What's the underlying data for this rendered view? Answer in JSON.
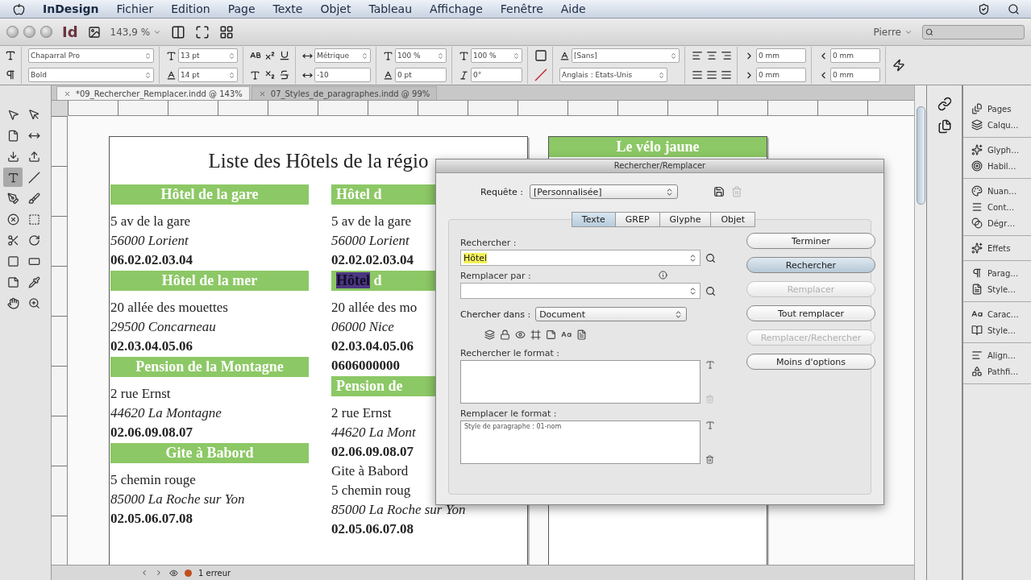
{
  "menu_bar": {
    "app": "InDesign",
    "items": [
      "Fichier",
      "Edition",
      "Page",
      "Texte",
      "Objet",
      "Tableau",
      "Affichage",
      "Fenêtre",
      "Aide"
    ]
  },
  "app_bar": {
    "logo": "Id",
    "zoom": "143,9 %",
    "workspace": "Pierre"
  },
  "control_panel": {
    "font_family": "Chaparral Pro",
    "font_style": "Bold",
    "font_size": "13 pt",
    "leading": "14 pt",
    "kerning": "Métrique",
    "tracking": "-10",
    "vertical_scale": "100 %",
    "baseline_shift": "0 pt",
    "horizontal_scale": "100 %",
    "skew": "0°",
    "character_style": "[Sans]",
    "language": "Anglais : Etats-Unis",
    "left_indent": "0 mm",
    "first_line_indent": "0 mm",
    "right_indent": "0 mm",
    "last_line_indent": "0 mm"
  },
  "tools": [
    {
      "selected": false
    },
    {
      "selected": false
    },
    {
      "selected": false
    },
    {
      "selected": false
    },
    {
      "selected": false
    },
    {
      "selected": false
    },
    {
      "selected": true
    },
    {
      "selected": false
    },
    {
      "selected": false
    },
    {
      "selected": false
    },
    {
      "selected": false
    },
    {
      "selected": false
    },
    {
      "selected": false
    },
    {
      "selected": false
    },
    {
      "selected": false
    },
    {
      "selected": false
    },
    {
      "selected": false
    },
    {
      "selected": false
    },
    {
      "selected": false
    },
    {
      "selected": false
    }
  ],
  "document_tabs": [
    {
      "label": "*09_Rechercher_Remplacer.indd @ 143%",
      "selected": true
    },
    {
      "label": "07_Styles_de_paragraphes.indd @ 99%",
      "selected": false
    }
  ],
  "page_1": {
    "title": "Liste des Hôtels de la régio",
    "column_1": [
      {
        "kind": "header",
        "text": "Hôtel de la gare"
      },
      {
        "kind": "line",
        "text": "5 av de la gare"
      },
      {
        "kind": "italic",
        "text": "56000 Lorient"
      },
      {
        "kind": "phone",
        "text": "06.02.02.03.04"
      },
      {
        "kind": "header",
        "text": "Hôtel de la mer"
      },
      {
        "kind": "line",
        "text": "20 allée des mouettes"
      },
      {
        "kind": "italic",
        "text": "29500 Concarneau"
      },
      {
        "kind": "phone",
        "text": "02.03.04.05.06"
      },
      {
        "kind": "header",
        "text": "Pension de la Montagne"
      },
      {
        "kind": "line",
        "text": "2 rue Ernst"
      },
      {
        "kind": "italic",
        "text": "44620 La Montagne"
      },
      {
        "kind": "phone",
        "text": "02.06.09.08.07"
      },
      {
        "kind": "header",
        "text": "Gite à Babord"
      },
      {
        "kind": "line",
        "text": "5 chemin rouge"
      },
      {
        "kind": "italic",
        "text": "85000 La Roche sur Yon"
      },
      {
        "kind": "phone",
        "text": "02.05.06.07.08"
      }
    ],
    "column_2": [
      {
        "kind": "header",
        "text": "Hôtel d"
      },
      {
        "kind": "line",
        "text": "5 av de la gare"
      },
      {
        "kind": "italic",
        "text": "56000 Lorient"
      },
      {
        "kind": "phone",
        "text": "02.02.02.03.04"
      },
      {
        "kind": "header",
        "text": " d",
        "selected_text": "Hôtel"
      },
      {
        "kind": "line",
        "text": "20 allée des mo"
      },
      {
        "kind": "italic",
        "text": "06000 Nice"
      },
      {
        "kind": "phone",
        "text": "02.03.04.05.06"
      },
      {
        "kind": "phone",
        "text": "0606000000"
      },
      {
        "kind": "header",
        "text": "Pension de"
      },
      {
        "kind": "line",
        "text": "2 rue Ernst"
      },
      {
        "kind": "italic",
        "text": "44620 La Mont"
      },
      {
        "kind": "phone",
        "text": "02.06.09.08.07"
      },
      {
        "kind": "line",
        "text": "Gite à Babord"
      },
      {
        "kind": "line",
        "text": "5 chemin roug"
      },
      {
        "kind": "italic",
        "text": "85000 La Roche sur Yon"
      },
      {
        "kind": "phone",
        "text": "02.05.06.07.08"
      }
    ]
  },
  "page_2": {
    "header": "Le vélo jaune"
  },
  "status_bar": {
    "errors": "1 erreur"
  },
  "panel_groups": [
    {
      "items": [
        "Pages",
        "Calqu…"
      ]
    },
    {
      "items": [
        "Glyph…",
        "Habil…"
      ]
    },
    {
      "items": [
        "Nuan…",
        "Cont…",
        "Dégr…"
      ]
    },
    {
      "items": [
        "Effets"
      ]
    },
    {
      "items": [
        "Parag…",
        "Style…"
      ]
    },
    {
      "items": [
        "Carac…",
        "Style…"
      ]
    },
    {
      "items": [
        "Align…",
        "Pathfi…"
      ]
    }
  ],
  "dialog": {
    "title": "Rechercher/Remplacer",
    "query_label": "Requête :",
    "query": "[Personnalisée]",
    "tabs": [
      {
        "label": "Texte",
        "selected": true
      },
      {
        "label": "GREP",
        "selected": false
      },
      {
        "label": "Glyphe",
        "selected": false
      },
      {
        "label": "Objet",
        "selected": false
      }
    ],
    "find_label": "Rechercher :",
    "find_value": "Hôtel",
    "replace_label": "Remplacer par :",
    "search_in_label": "Chercher dans :",
    "search_in": "Document",
    "find_format_label": "Rechercher le format :",
    "replace_format_label": "Remplacer le format :",
    "replace_format": "Style de paragraphe : 01-nom",
    "buttons": [
      {
        "label": "Terminer",
        "default": false,
        "disabled": false
      },
      {
        "label": "Rechercher",
        "default": true,
        "disabled": false
      },
      {
        "label": "Remplacer",
        "default": false,
        "disabled": true
      },
      {
        "label": "Tout remplacer",
        "default": false,
        "disabled": false
      },
      {
        "label": "Remplacer/Rechercher",
        "default": false,
        "disabled": true
      },
      {
        "label": "Moins d'options",
        "default": false,
        "disabled": false
      }
    ]
  }
}
